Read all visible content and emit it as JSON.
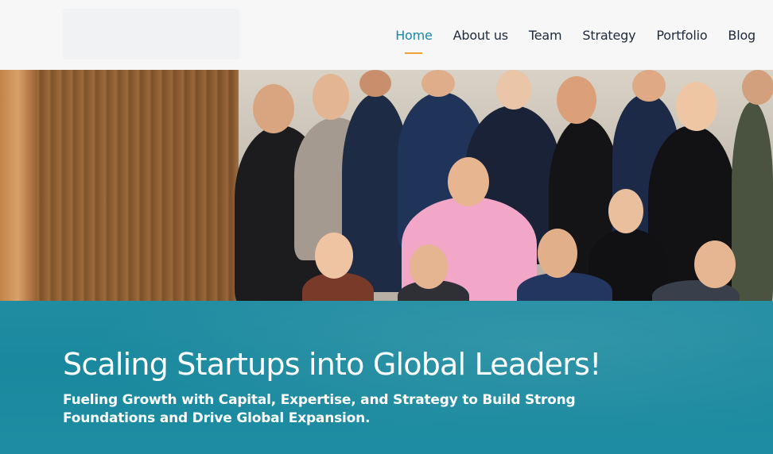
{
  "header": {
    "nav": [
      {
        "label": "Home",
        "active": true
      },
      {
        "label": "About us",
        "active": false
      },
      {
        "label": "Team",
        "active": false
      },
      {
        "label": "Strategy",
        "active": false
      },
      {
        "label": "Portfolio",
        "active": false
      },
      {
        "label": "Blog",
        "active": false
      }
    ],
    "accent_color": "#1a87a6",
    "underline_color": "#f0a334"
  },
  "hero": {
    "image": "team-group-photo",
    "title": "Scaling Startups into Global Leaders!",
    "subtitle": "Fueling Growth with Capital, Expertise, and Strategy to Build Strong Foundations and Drive Global Expansion.",
    "band_color": "#1a8aa0"
  }
}
